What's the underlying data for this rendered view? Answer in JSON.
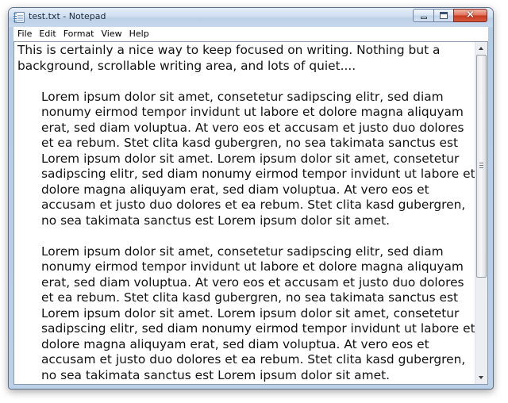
{
  "window": {
    "title": "test.txt - Notepad",
    "close_glyph": "×"
  },
  "menu": [
    "File",
    "Edit",
    "Format",
    "View",
    "Help"
  ],
  "document": {
    "paragraphs": [
      "This is certainly a nice way to keep focused on writing. Nothing but a background, scrollable writing area, and lots of quiet....",
      "Lorem ipsum dolor sit amet, consetetur sadipscing elitr, sed diam nonumy eirmod tempor invidunt ut labore et dolore magna aliquyam erat, sed diam voluptua. At vero eos et accusam et justo duo dolores et ea rebum. Stet clita kasd gubergren, no sea takimata sanctus est Lorem ipsum dolor sit amet. Lorem ipsum dolor sit amet, consetetur sadipscing elitr, sed diam nonumy eirmod tempor invidunt ut labore et dolore magna aliquyam erat, sed diam voluptua. At vero eos et accusam et justo duo dolores et ea rebum. Stet clita kasd gubergren, no sea takimata sanctus est Lorem ipsum dolor sit amet.",
      "Lorem ipsum dolor sit amet, consetetur sadipscing elitr, sed diam nonumy eirmod tempor invidunt ut labore et dolore magna aliquyam erat, sed diam voluptua. At vero eos et accusam et justo duo dolores et ea rebum. Stet clita kasd gubergren, no sea takimata sanctus est Lorem ipsum dolor sit amet. Lorem ipsum dolor sit amet, consetetur sadipscing elitr, sed diam nonumy eirmod tempor invidunt ut labore et dolore magna aliquyam erat, sed diam voluptua. At vero eos et accusam et justo duo dolores et ea rebum. Stet clita kasd gubergren, no sea takimata sanctus est Lorem ipsum dolor sit amet."
    ]
  },
  "icons": {
    "app": "notepad-icon",
    "minimize": "minimize-icon",
    "maximize": "maximize-icon",
    "close": "close-icon",
    "scroll_up": "arrow-up-icon",
    "scroll_down": "arrow-down-icon"
  },
  "colors": {
    "frame": "#bcd0e8",
    "close_button": "#c8391f",
    "text": "#111111"
  }
}
